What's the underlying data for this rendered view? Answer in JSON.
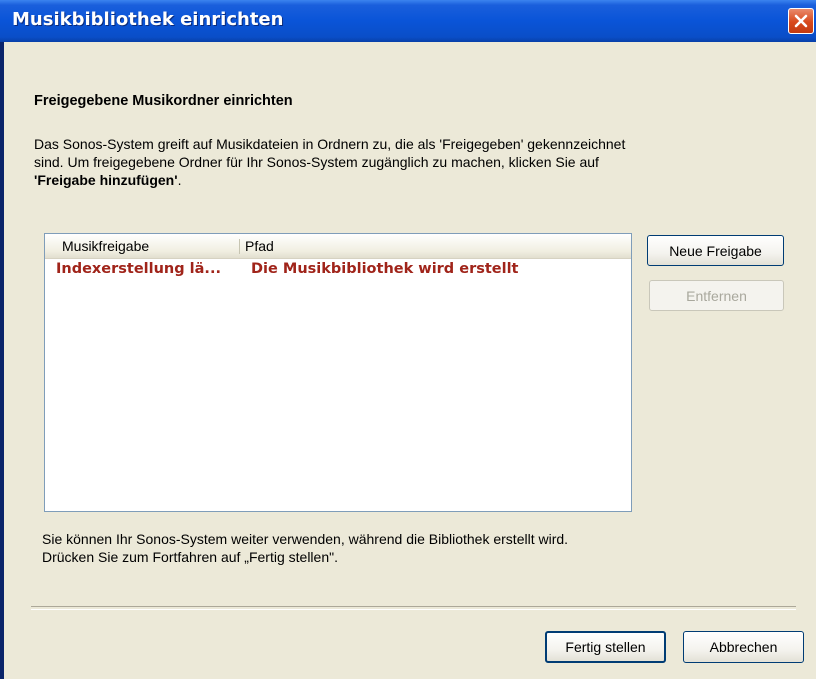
{
  "window": {
    "title": "Musikbibliothek einrichten",
    "close_label": "×"
  },
  "content": {
    "heading": "Freigegebene Musikordner einrichten",
    "description_lines": [
      "Das Sonos-System greift auf Musikdateien in Ordnern zu, die als 'Freigegeben' gekennzeichnet",
      "sind. Um freigegebene Ordner für Ihr Sonos-System zugänglich zu machen, klicken Sie auf"
    ],
    "description_link": "'Freigabe hinzufügen'",
    "description_end": ".",
    "list": {
      "columns": [
        "Musikfreigabe",
        "Pfad"
      ],
      "rows": [
        {
          "share": "Indexerstellung lä...",
          "path": "Die Musikbibliothek wird erstellt"
        }
      ]
    },
    "buttons": {
      "new_share": "Neue Freigabe",
      "remove": "Entfernen"
    },
    "info_lines": [
      "Sie können Ihr Sonos-System weiter verwenden, während die Bibliothek erstellt wird.",
      "Drücken Sie zum Fortfahren auf „Fertig stellen\"."
    ]
  },
  "footer": {
    "finish": "Fertig stellen",
    "cancel": "Abbrechen"
  },
  "colors": {
    "titlebar": "#0a54d8",
    "dialog_bg": "#ece9d8",
    "status_text": "#a0241a"
  }
}
